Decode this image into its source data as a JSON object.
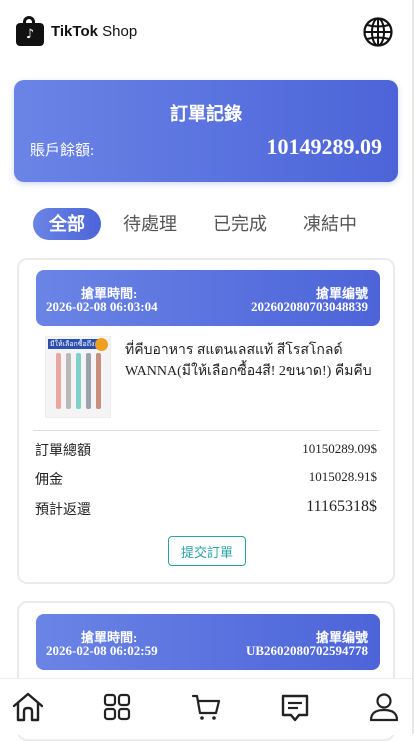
{
  "header": {
    "logo_glyph": "♪",
    "brand_bold": "TikTok",
    "brand_light": " Shop",
    "globe_icon": "globe-icon"
  },
  "record": {
    "title": "訂單記錄",
    "balance_label": "賬戶餘額:",
    "balance_value": "10149289.09"
  },
  "tabs": [
    {
      "label": "全部",
      "active": true
    },
    {
      "label": "待處理",
      "active": false
    },
    {
      "label": "已完成",
      "active": false
    },
    {
      "label": "凍結中",
      "active": false
    }
  ],
  "orders": [
    {
      "time_label": "搶單時間:",
      "time_value": "2026-02-08 06:03:04",
      "id_label": "搶單编號",
      "id_value": "20260208070304883​9",
      "product_name": "ที่คีบอาหาร สแตนเลสแท้ สีโรสโกลด์ WANNA(มีให้เลือกซื้อ4สี! 2ขนาด!) คีมคีบอาหาร",
      "product_image_banner": "มีให้เลือกซื้อถึง",
      "total_label": "訂單總額",
      "total_value": "10150289.09$",
      "commission_label": "佣金",
      "commission_value": "1015028.91$",
      "return_label": "預計返還",
      "return_value": "11165318$",
      "submit_label": "提交訂單"
    },
    {
      "time_label": "搶單時間:",
      "time_value": "2026-02-08 06:02:59",
      "id_label": "搶單编號",
      "id_value": "UB2602080702594778"
    }
  ],
  "bottom_nav": [
    {
      "icon": "home-icon"
    },
    {
      "icon": "grid-icon"
    },
    {
      "icon": "cart-icon"
    },
    {
      "icon": "orders-icon"
    },
    {
      "icon": "profile-icon"
    }
  ]
}
